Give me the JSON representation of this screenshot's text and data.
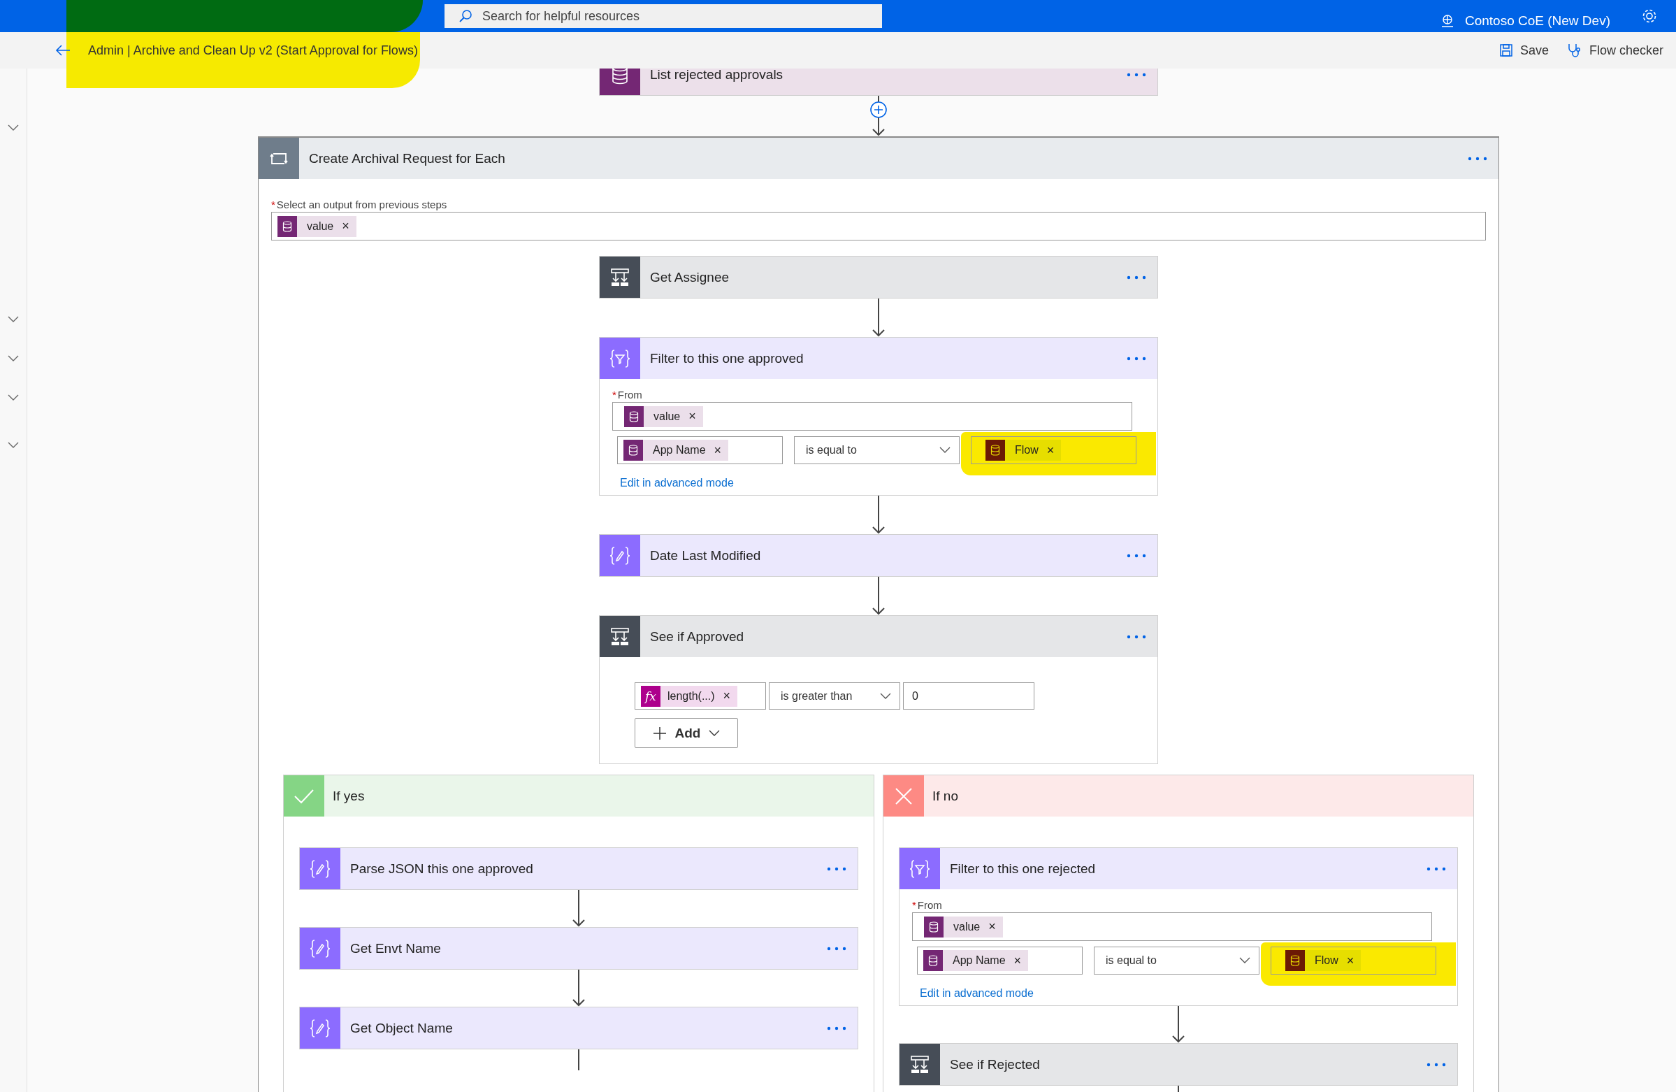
{
  "top_bar": {
    "search_placeholder": "Search for helpful resources",
    "environment": "Contoso CoE (New Dev)"
  },
  "header": {
    "title": "Admin | Archive and Clean Up v2 (Start Approval for Flows)",
    "highlighted": true,
    "actions": [
      {
        "label": "Save",
        "kind": "save"
      },
      {
        "label": "Flow checker",
        "kind": "checker"
      }
    ]
  },
  "steps": [
    {
      "title": "List rejected approvals",
      "kind": "dataverse"
    },
    {
      "title": "Create Archival Request for Each",
      "kind": "loop",
      "required_mark": "*",
      "field_label": "Select an output from previous steps",
      "tokens": [
        {
          "label": "value",
          "kind": "dataverse",
          "remove": "×"
        }
      ],
      "steps": [
        {
          "title": "Get Assignee",
          "kind": "condition"
        },
        {
          "title": "Filter to this one approved",
          "kind": "filter",
          "required_mark": "*",
          "from_label": "From",
          "from_token": {
            "label": "value",
            "kind": "dataverse",
            "remove": "×"
          },
          "left_token": {
            "label": "App Name",
            "kind": "dataverse",
            "remove": "×"
          },
          "operator": "is equal to",
          "right_token": {
            "label": "Flow",
            "kind": "dataverse",
            "remove": "×",
            "highlighted": true
          },
          "link": "Edit in advanced mode"
        },
        {
          "title": "Date Last Modified",
          "kind": "variable"
        },
        {
          "title": "See if Approved",
          "kind": "condition",
          "left_token": {
            "label": "length(...)",
            "kind": "expression",
            "icon_label": "fx",
            "remove": "×"
          },
          "operator": "is greater than",
          "value": "0",
          "add_button": "Add",
          "branches": [
            {
              "label": "If yes",
              "kind": "yes",
              "steps": [
                {
                  "title": "Parse JSON this one approved",
                  "kind": "variable"
                },
                {
                  "title": "Get Envt Name",
                  "kind": "variable"
                },
                {
                  "title": "Get Object Name",
                  "kind": "variable"
                }
              ]
            },
            {
              "label": "If no",
              "kind": "no",
              "steps": [
                {
                  "title": "Filter to this one rejected",
                  "kind": "filter",
                  "required_mark": "*",
                  "from_label": "From",
                  "from_token": {
                    "label": "value",
                    "kind": "dataverse",
                    "remove": "×"
                  },
                  "left_token": {
                    "label": "App Name",
                    "kind": "dataverse",
                    "remove": "×"
                  },
                  "operator": "is equal to",
                  "right_token": {
                    "label": "Flow",
                    "kind": "dataverse",
                    "remove": "×",
                    "highlighted": true
                  },
                  "link": "Edit in advanced mode"
                },
                {
                  "title": "See if Rejected",
                  "kind": "condition"
                }
              ]
            }
          ]
        }
      ]
    }
  ]
}
